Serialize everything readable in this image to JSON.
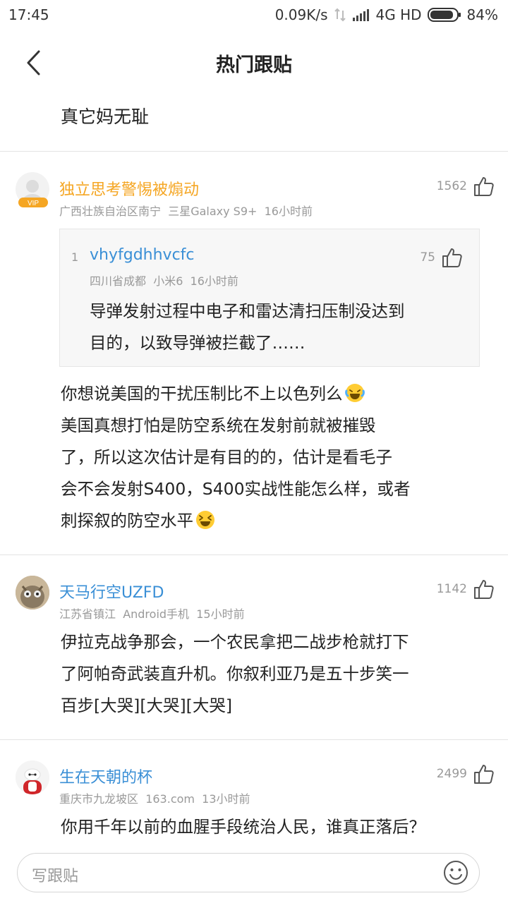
{
  "status_bar": {
    "time": "17:45",
    "net_speed": "0.09K/s",
    "network": "4G HD",
    "battery": "84%"
  },
  "nav": {
    "title": "热门跟贴"
  },
  "quoted_text": "真它妈无耻",
  "comments": [
    {
      "username": "独立思考警惕被煽动",
      "username_color": "#f5a623",
      "vip_badge": "VIP",
      "location": "广西壮族自治区南宁",
      "device": "三星Galaxy S9+",
      "time": "16小时前",
      "likes": "1562",
      "nested_reply": {
        "floor": "1",
        "username": "vhyfgdhhvcfc",
        "location": "四川省成都",
        "device": "小米6",
        "time": "16小时前",
        "likes": "75",
        "lines": [
          "导弹发射过程中电子和雷达清扫压制没达到",
          "目的，以致导弹被拦截了……"
        ]
      },
      "lines": [
        "你想说美国的干扰压制比不上以色列么",
        "美国真想打怕是防空系统在发射前就被摧毁",
        "了，所以这次估计是有目的的，估计是看毛子",
        "会不会发射S400，S400实战性能怎么样，或者",
        "刺探叙的防空水平"
      ],
      "emojis": [
        "laughing-tears",
        "squinting-laugh"
      ]
    },
    {
      "username": "天马行空UZFD",
      "username_color": "#3a8fd6",
      "location": "江苏省镇江",
      "device": "Android手机",
      "time": "15小时前",
      "likes": "1142",
      "lines": [
        "伊拉克战争那会，一个农民拿把二战步枪就打下",
        "了阿帕奇武装直升机。你叙利亚乃是五十步笑一",
        "百步[大哭][大哭][大哭]"
      ]
    },
    {
      "username": "生在天朝的杯",
      "username_color": "#3a8fd6",
      "location": "重庆市九龙坡区",
      "device": "163.com",
      "time": "13小时前",
      "likes": "2499",
      "lines": [
        "你用千年以前的血腥手段统治人民，谁真正落后？"
      ]
    }
  ],
  "reply_bar": {
    "placeholder": "写跟贴",
    "icon": "smile-icon"
  }
}
